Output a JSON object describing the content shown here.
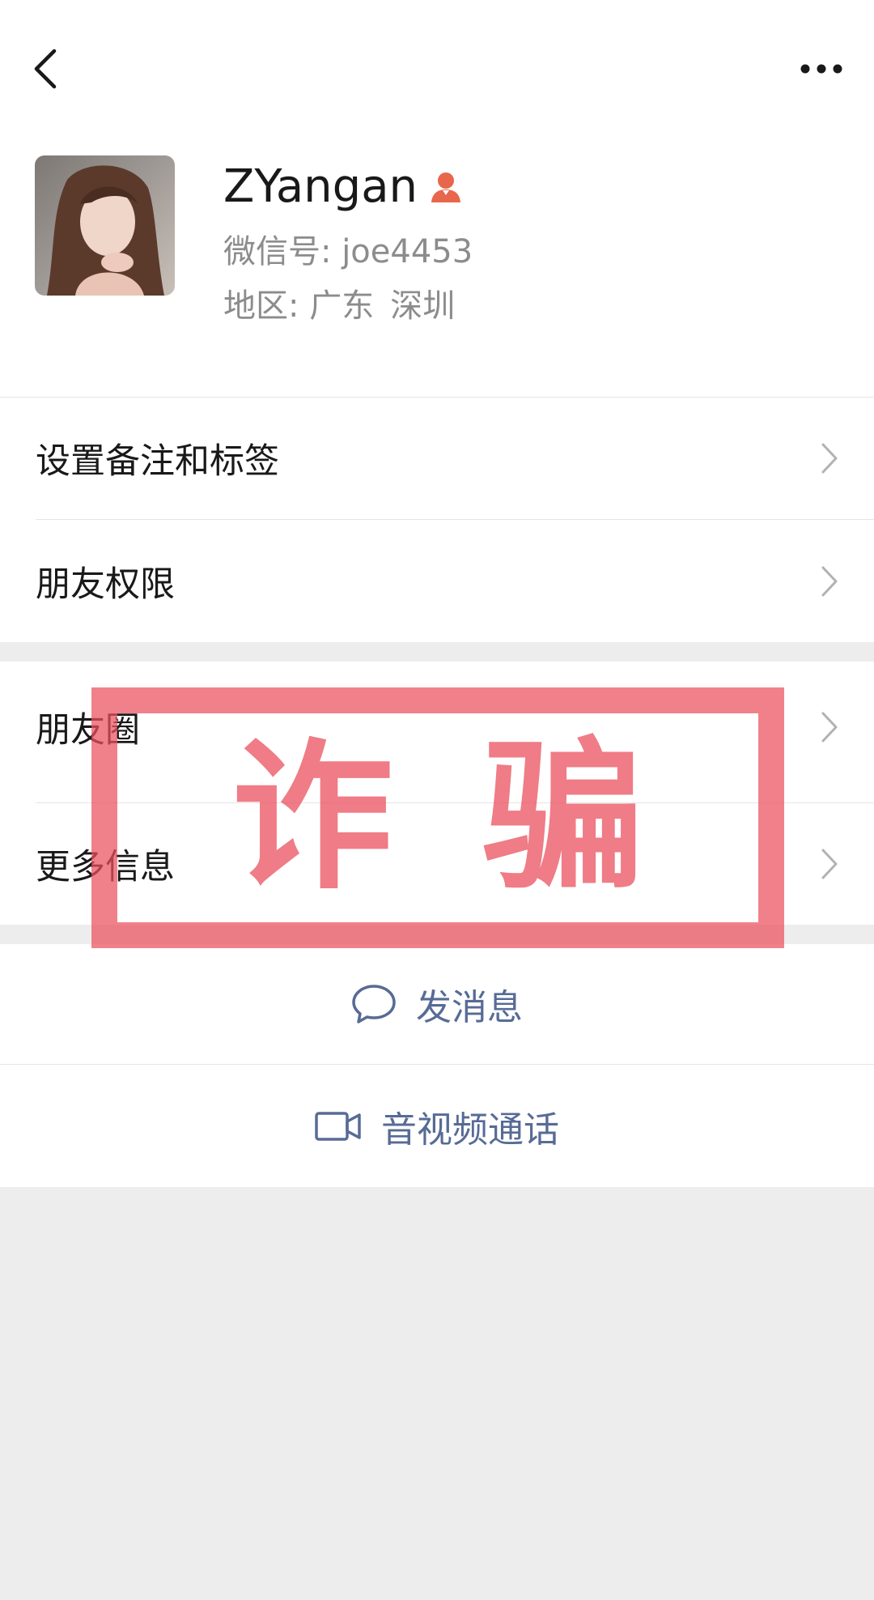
{
  "profile": {
    "name": "ZYangan",
    "gender_icon": "female-icon",
    "wechat_id_text": "微信号: joe4453",
    "region_label": "地区: 广东",
    "region_city": "深圳"
  },
  "menu_group_1": [
    {
      "label": "设置备注和标签",
      "icon": "chevron-right-icon"
    },
    {
      "label": "朋友权限",
      "icon": "chevron-right-icon"
    }
  ],
  "menu_group_2": [
    {
      "label": "朋友圈",
      "icon": "chevron-right-icon"
    },
    {
      "label": "更多信息",
      "icon": "chevron-right-icon"
    }
  ],
  "actions": [
    {
      "label": "发消息",
      "icon": "chat-bubble-icon"
    },
    {
      "label": "音视频通话",
      "icon": "video-camera-icon"
    }
  ],
  "stamp": {
    "text": "诈骗",
    "color": "#ea505e"
  },
  "colors": {
    "link": "#576b95",
    "background": "#ededed",
    "gender_icon": "#e8664b"
  }
}
